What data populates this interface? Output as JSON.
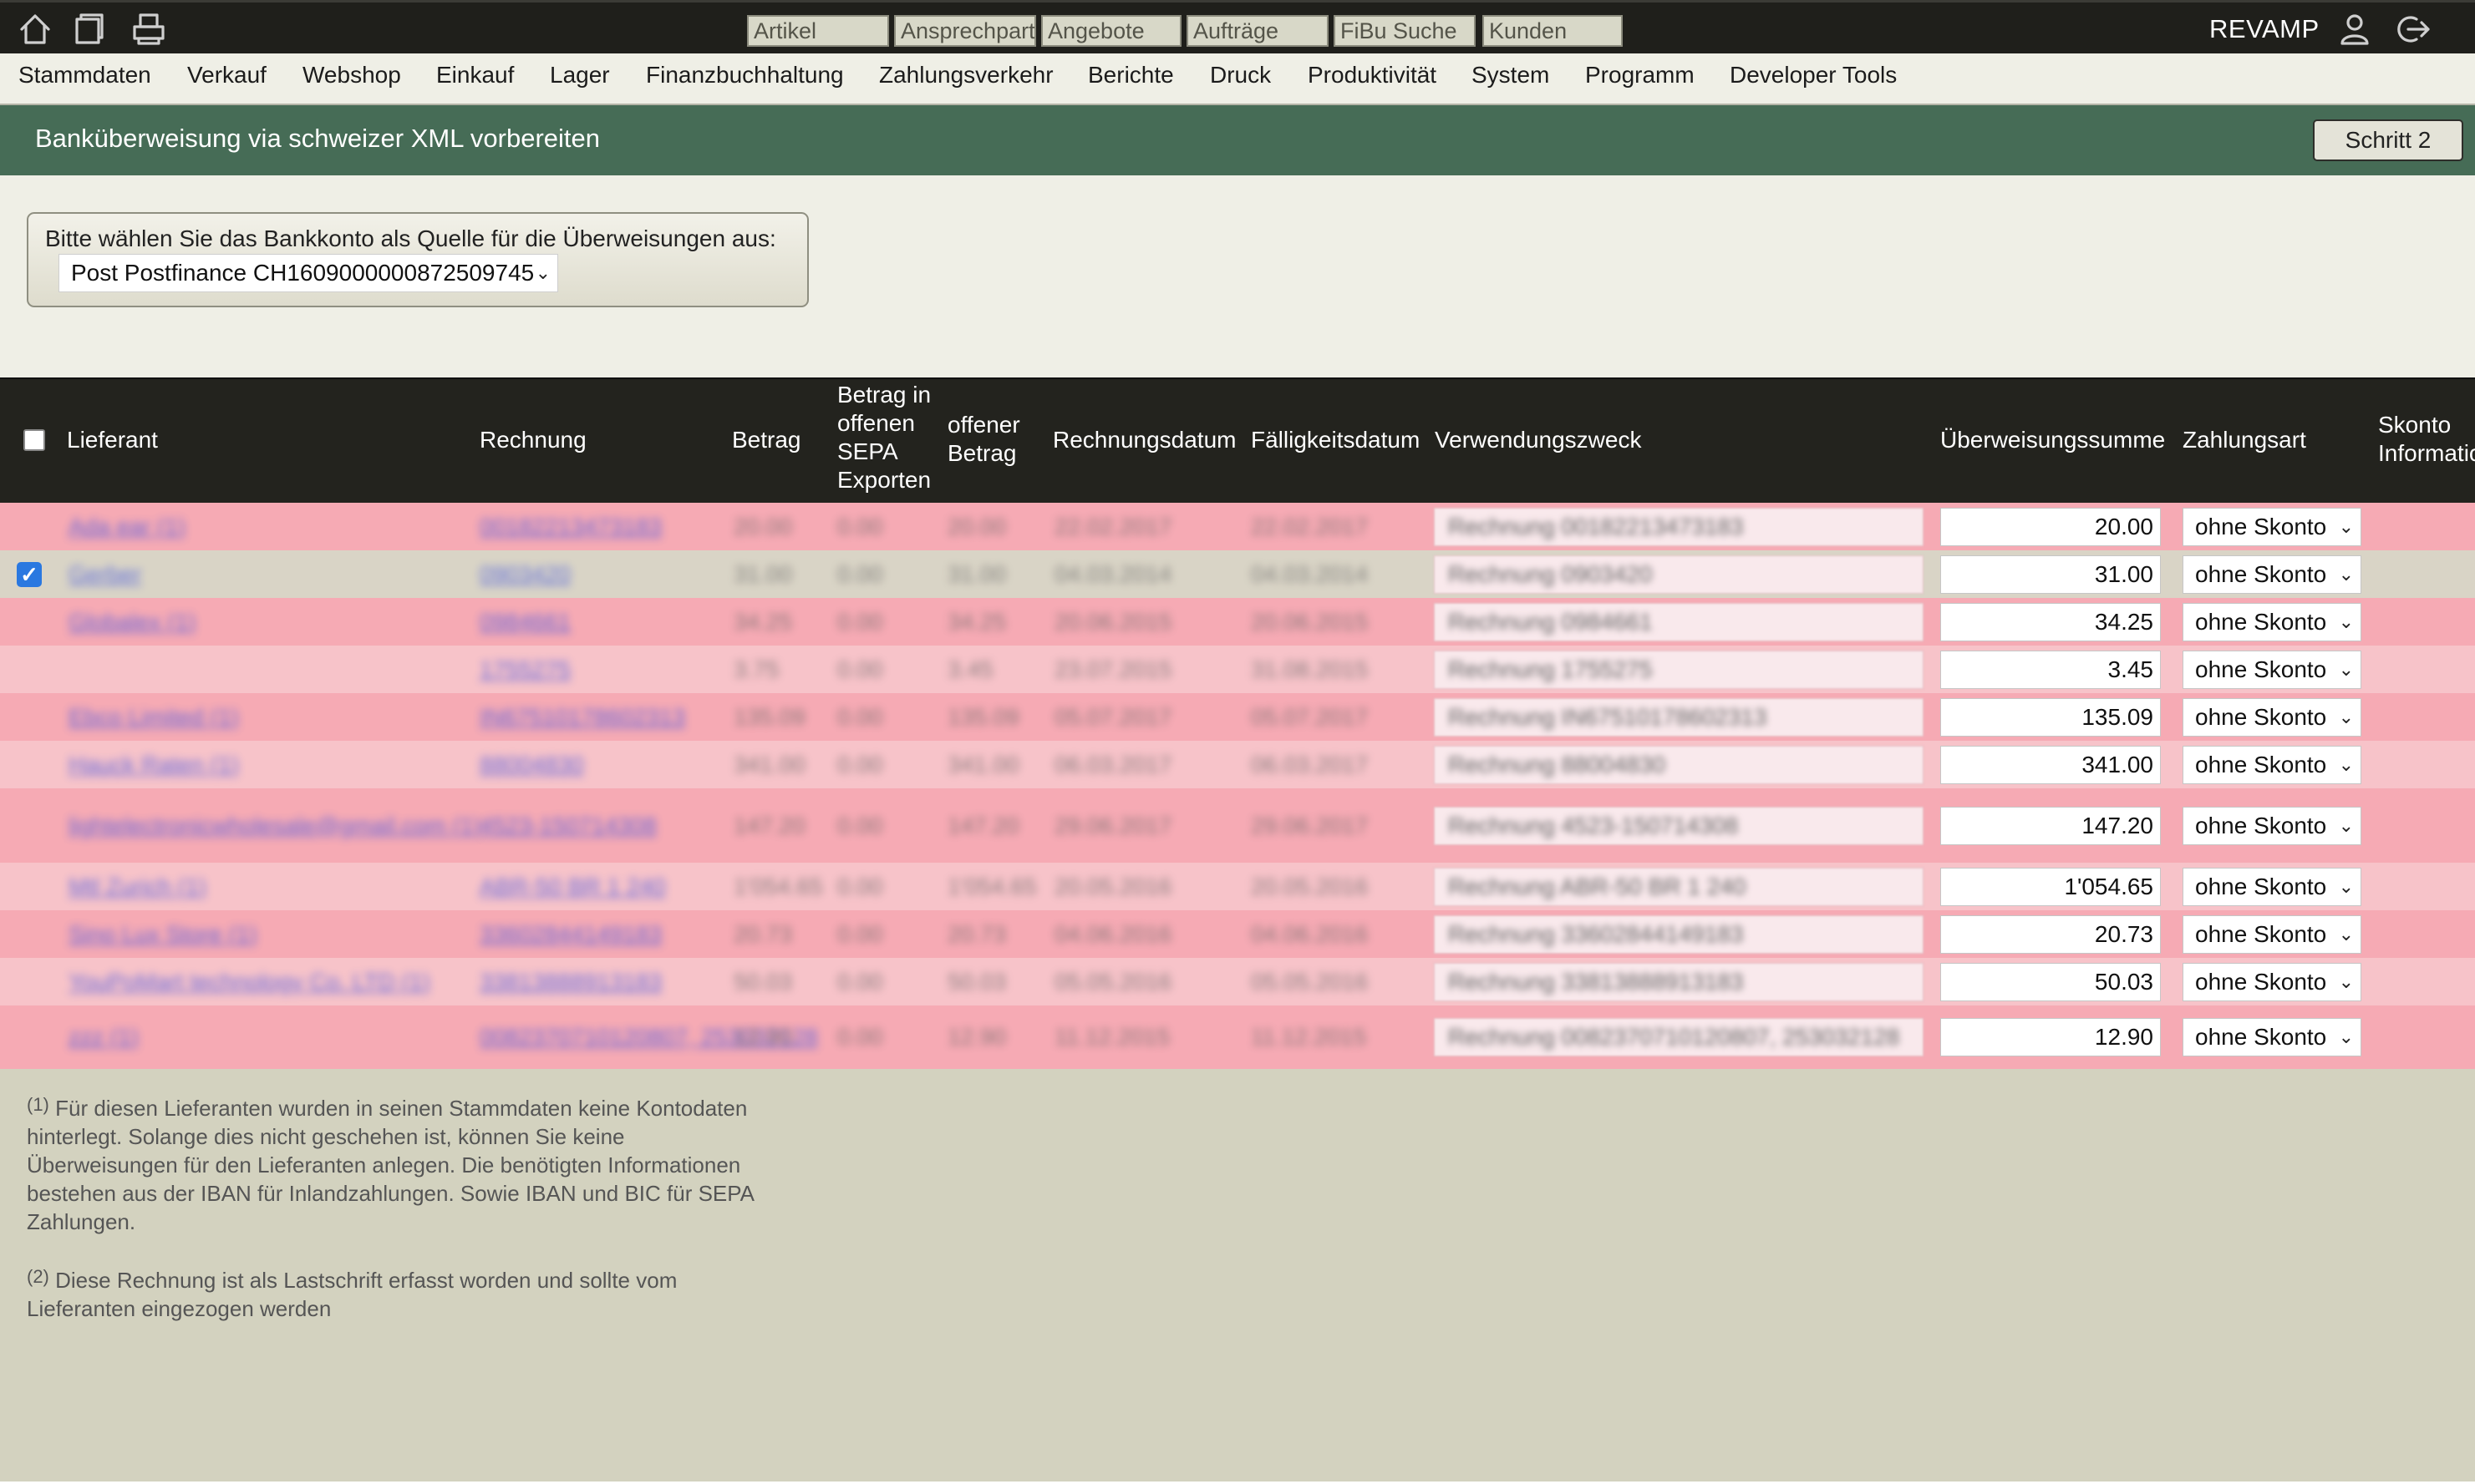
{
  "toolbar": {
    "icons": [
      "home-icon",
      "windows-icon",
      "printer-icon",
      "user-icon",
      "logout-icon"
    ],
    "quick_search": [
      "Artikel",
      "Ansprechpartner",
      "Angebote",
      "Aufträge",
      "FiBu Suche",
      "Kunden"
    ],
    "brand": "REVAMP"
  },
  "menu": [
    "Stammdaten",
    "Verkauf",
    "Webshop",
    "Einkauf",
    "Lager",
    "Finanzbuchhaltung",
    "Zahlungsverkehr",
    "Berichte",
    "Druck",
    "Produktivität",
    "System",
    "Programm",
    "Developer Tools"
  ],
  "page": {
    "title": "Banküberweisung via schweizer XML vorbereiten",
    "step_button": "Schritt 2"
  },
  "bank": {
    "label": "Bitte wählen Sie das Bankkonto als Quelle für die Überweisungen aus:",
    "selected": "Post Postfinance CH1609000000872509745"
  },
  "table": {
    "headers": {
      "lieferant": "Lieferant",
      "rechnung": "Rechnung",
      "betrag": "Betrag",
      "sepa": [
        "Betrag in",
        "offenen",
        "SEPA",
        "Exporten"
      ],
      "offen": [
        "offener",
        "Betrag"
      ],
      "rechnungsdatum": "Rechnungsdatum",
      "faelligkeitsdatum": "Fälligkeitsdatum",
      "verwendungszweck": "Verwendungszweck",
      "summe": "Überweisungssumme",
      "zahlungsart": "Zahlungsart",
      "skonto": [
        "Skonto",
        "Information"
      ]
    },
    "rows": [
      {
        "checked": false,
        "style": "pink",
        "lieferant": "Ada ear (1)",
        "rechnung": "00182213473183",
        "betrag": "20.00",
        "sepa": "0.00",
        "offen": "20.00",
        "rdatum": "22.02.2017",
        "fdatum": "22.02.2017",
        "zweck": "Rechnung 00182213473183",
        "summe": "20.00",
        "zahlungsart": "ohne Skonto"
      },
      {
        "checked": true,
        "style": "gray",
        "lieferant": "Gerber",
        "rechnung": "0903420",
        "betrag": "31.00",
        "sepa": "0.00",
        "offen": "31.00",
        "rdatum": "04.03.2014",
        "fdatum": "04.03.2014",
        "zweck": "Rechnung 0903420",
        "summe": "31.00",
        "zahlungsart": "ohne Skonto"
      },
      {
        "checked": false,
        "style": "pink",
        "lieferant": "Globalex (1)",
        "rechnung": "0984661",
        "betrag": "34.25",
        "sepa": "0.00",
        "offen": "34.25",
        "rdatum": "20.06.2015",
        "fdatum": "20.06.2015",
        "zweck": "Rechnung 0984661",
        "summe": "34.25",
        "zahlungsart": "ohne Skonto"
      },
      {
        "checked": false,
        "style": "light",
        "lieferant": "",
        "rechnung": "1755275",
        "betrag": "3.75",
        "sepa": "0.00",
        "offen": "3.45",
        "rdatum": "23.07.2015",
        "fdatum": "31.08.2015",
        "zweck": "Rechnung 1755275",
        "summe": "3.45",
        "zahlungsart": "ohne Skonto"
      },
      {
        "checked": false,
        "style": "pink",
        "lieferant": "Ebco Limited (1)",
        "rechnung": "IN67510178602313",
        "betrag": "135.09",
        "sepa": "0.00",
        "offen": "135.09",
        "rdatum": "05.07.2017",
        "fdatum": "05.07.2017",
        "zweck": "Rechnung IN67510178602313",
        "summe": "135.09",
        "zahlungsart": "ohne Skonto"
      },
      {
        "checked": false,
        "style": "light",
        "lieferant": "Hauck Raten (1)",
        "rechnung": "88004830",
        "betrag": "341.00",
        "sepa": "0.00",
        "offen": "341.00",
        "rdatum": "06.03.2017",
        "fdatum": "06.03.2017",
        "zweck": "Rechnung 88004830",
        "summe": "341.00",
        "zahlungsart": "ohne Skonto"
      },
      {
        "checked": false,
        "style": "pink",
        "lieferant": "lightelectronicwholesale@gmail.com (1)",
        "rechnung": "4523-150714308",
        "betrag": "147.20",
        "sepa": "0.00",
        "offen": "147.20",
        "rdatum": "29.06.2017",
        "fdatum": "29.06.2017",
        "zweck": "Rechnung 4523-150714308",
        "summe": "147.20",
        "zahlungsart": "ohne Skonto"
      },
      {
        "checked": false,
        "style": "light",
        "lieferant": "Mtl Zurich (1)",
        "rechnung": "ABR-50 BR 1 240",
        "betrag": "1'054.65",
        "sepa": "0.00",
        "offen": "1'054.65",
        "rdatum": "20.05.2016",
        "fdatum": "20.05.2016",
        "zweck": "Rechnung ABR-50 BR 1 240",
        "summe": "1'054.65",
        "zahlungsart": "ohne Skonto"
      },
      {
        "checked": false,
        "style": "pink",
        "lieferant": "Sino Lux Store (1)",
        "rechnung": "33602844149183",
        "betrag": "20.73",
        "sepa": "0.00",
        "offen": "20.73",
        "rdatum": "04.06.2016",
        "fdatum": "04.06.2016",
        "zweck": "Rechnung 33602844149183",
        "summe": "20.73",
        "zahlungsart": "ohne Skonto"
      },
      {
        "checked": false,
        "style": "light",
        "lieferant": "YouPoMart technology Co. LTD (1)",
        "rechnung": "33813888913183",
        "betrag": "50.03",
        "sepa": "0.00",
        "offen": "50.03",
        "rdatum": "05.05.2016",
        "fdatum": "05.05.2016",
        "zweck": "Rechnung 33813888913183",
        "summe": "50.03",
        "zahlungsart": "ohne Skonto"
      },
      {
        "checked": false,
        "style": "pink",
        "lieferant": "zzz (1)",
        "rechnung": "0082370710120807, 253032128",
        "betrag": "12.90",
        "sepa": "0.00",
        "offen": "12.90",
        "rdatum": "11.12.2015",
        "fdatum": "11.12.2015",
        "zweck": "Rechnung 0082370710120807, 253032128",
        "summe": "12.90",
        "zahlungsart": "ohne Skonto"
      }
    ]
  },
  "footnotes": [
    {
      "mark": "(1)",
      "text": "Für diesen Lieferanten wurden in seinen Stammdaten keine Kontodaten hinterlegt. Solange dies nicht geschehen ist, können Sie keine Überweisungen für den Lieferanten anlegen. Die benötigten Informationen bestehen aus der IBAN für Inlandzahlungen. Sowie IBAN und BIC für SEPA Zahlungen."
    },
    {
      "mark": "(2)",
      "text": "Diese Rechnung ist als Lastschrift erfasst worden und sollte vom Lieferanten eingezogen werden"
    }
  ],
  "colors": {
    "toolbar": "#1f1f1b",
    "titlebar": "#466c56",
    "row_pink": "#f6aab4",
    "row_light": "#f7c3c9",
    "row_selected": "#d9d4c6"
  }
}
